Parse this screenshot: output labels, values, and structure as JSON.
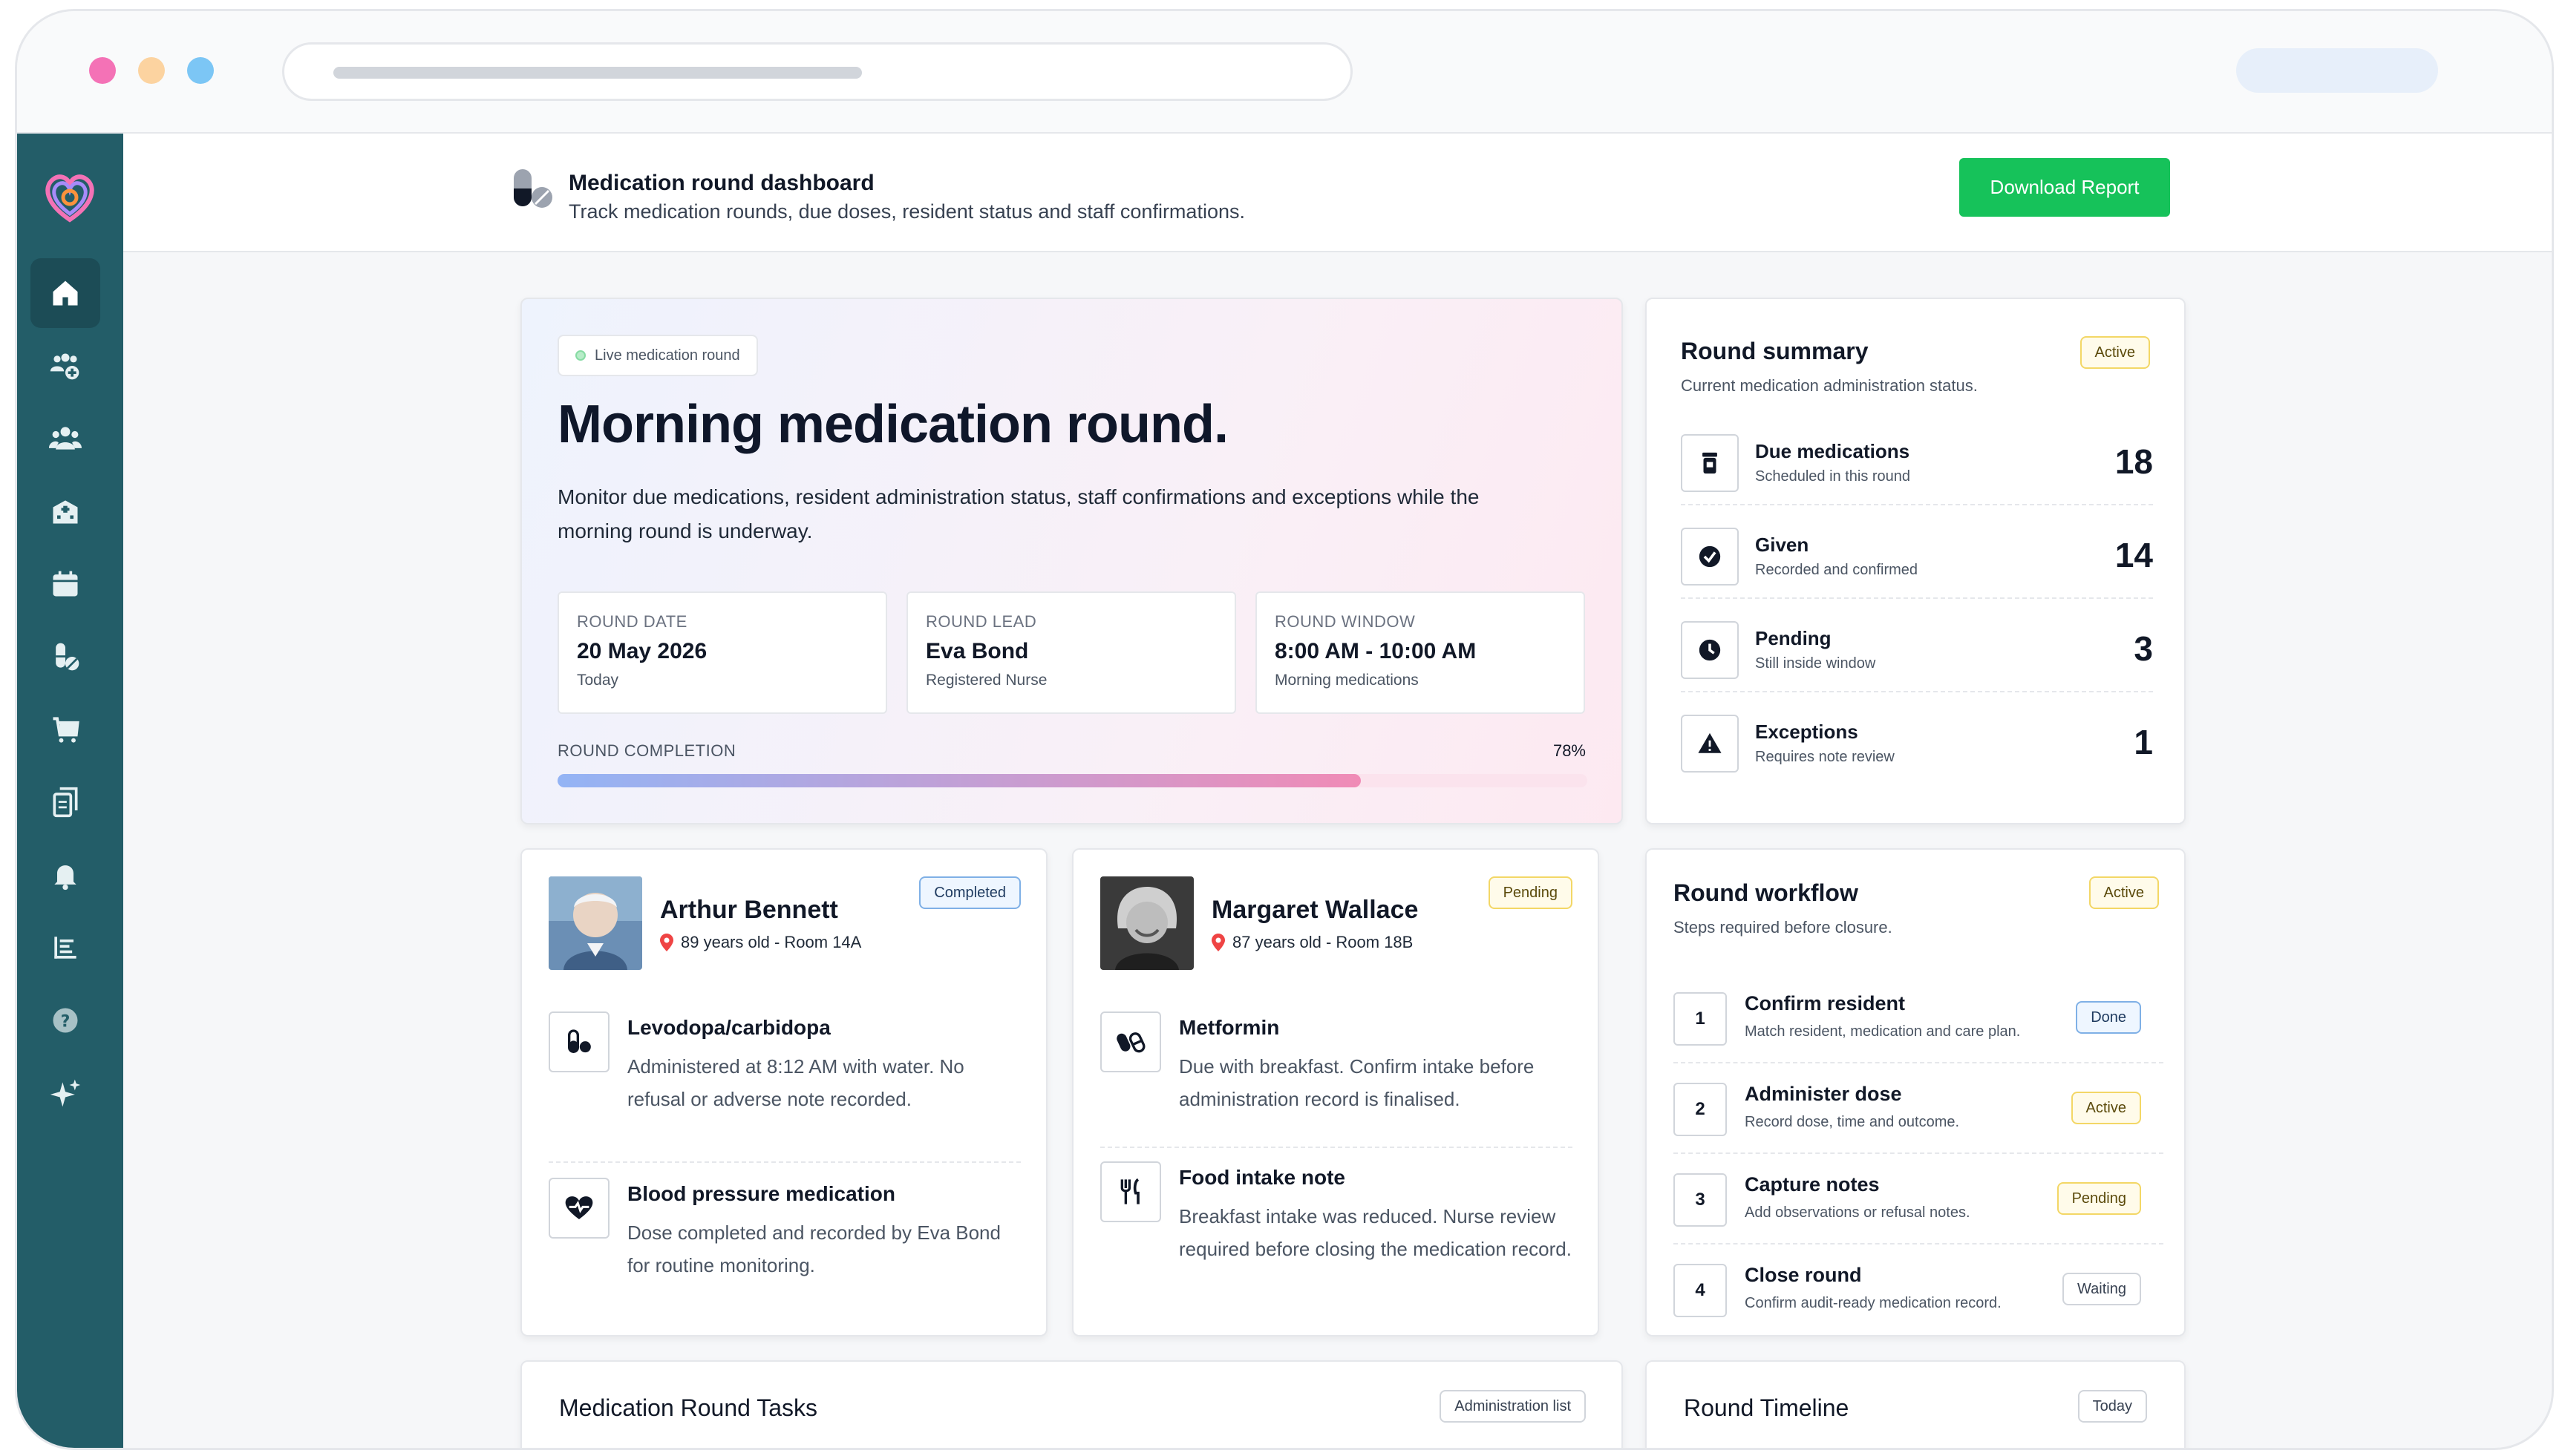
{
  "header": {
    "title": "Medication round dashboard",
    "subtitle": "Track medication rounds, due doses, resident status and staff confirmations.",
    "download_label": "Download Report"
  },
  "sidebar": {
    "items": [
      {
        "icon": "home-icon",
        "active": true
      },
      {
        "icon": "add-user-group-icon"
      },
      {
        "icon": "users-icon"
      },
      {
        "icon": "building-icon"
      },
      {
        "icon": "calendar-icon"
      },
      {
        "icon": "pill-icon"
      },
      {
        "icon": "cart-icon"
      },
      {
        "icon": "documents-icon"
      },
      {
        "icon": "bell-icon"
      },
      {
        "icon": "list-icon"
      },
      {
        "icon": "help-icon"
      },
      {
        "icon": "sparkle-icon"
      }
    ]
  },
  "hero": {
    "chip": "Live medication round",
    "title": "Morning medication round.",
    "description": "Monitor due medications, resident administration status, staff confirmations and exceptions while the morning round is underway.",
    "info": [
      {
        "key": "Round date",
        "value": "20 May 2026",
        "sub": "Today"
      },
      {
        "key": "Round lead",
        "value": "Eva Bond",
        "sub": "Registered Nurse"
      },
      {
        "key": "Round window",
        "value": "8:00 AM - 10:00 AM",
        "sub": "Morning medications"
      }
    ],
    "progress_label": "Round completion",
    "progress_text": "78%",
    "progress_value": 78
  },
  "summary": {
    "title": "Round summary",
    "badge": "Active",
    "subtitle": "Current medication administration status.",
    "rows": [
      {
        "label": "Due medications",
        "sub": "Scheduled in this round",
        "value": "18"
      },
      {
        "label": "Given",
        "sub": "Recorded and confirmed",
        "value": "14"
      },
      {
        "label": "Pending",
        "sub": "Still inside window",
        "value": "3"
      },
      {
        "label": "Exceptions",
        "sub": "Requires note review",
        "value": "1"
      }
    ]
  },
  "residents": [
    {
      "name": "Arthur Bennett",
      "meta": "89 years old - Room 14A",
      "badge": "Completed",
      "meds": [
        {
          "title": "Levodopa/carbidopa",
          "desc": "Administered at 8:12 AM with water. No refusal or adverse note recorded."
        },
        {
          "title": "Blood pressure medication",
          "desc": "Dose completed and recorded by Eva Bond for routine monitoring."
        }
      ]
    },
    {
      "name": "Margaret Wallace",
      "meta": "87 years old - Room 18B",
      "badge": "Pending",
      "meds": [
        {
          "title": "Metformin",
          "desc": "Due with breakfast. Confirm intake before administration record is finalised."
        },
        {
          "title": "Food intake note",
          "desc": "Breakfast intake was reduced. Nurse review required before closing the medication record."
        }
      ]
    }
  ],
  "workflow": {
    "title": "Round workflow",
    "badge": "Active",
    "subtitle": "Steps required before closure.",
    "steps": [
      {
        "num": "1",
        "title": "Confirm resident",
        "sub": "Match resident, medication and care plan.",
        "status": "Done"
      },
      {
        "num": "2",
        "title": "Administer dose",
        "sub": "Record dose, time and outcome.",
        "status": "Active"
      },
      {
        "num": "3",
        "title": "Capture notes",
        "sub": "Add observations or refusal notes.",
        "status": "Pending"
      },
      {
        "num": "4",
        "title": "Close round",
        "sub": "Confirm audit-ready medication record.",
        "status": "Waiting"
      }
    ]
  },
  "tasks": {
    "title": "Medication Round Tasks",
    "badge": "Administration list"
  },
  "timeline": {
    "title": "Round Timeline",
    "badge": "Today"
  }
}
